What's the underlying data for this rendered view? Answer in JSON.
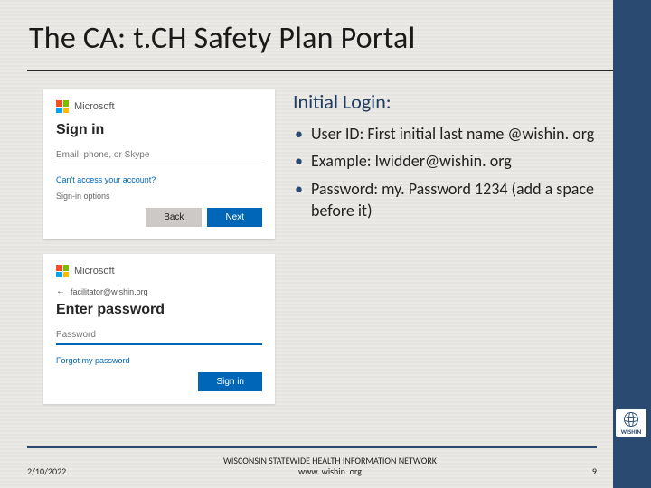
{
  "title": "The CA: t.CH Safety Plan Portal",
  "right": {
    "heading": "Initial Login:",
    "bullets": [
      "User ID:  First initial last name @wishin. org",
      "Example:  lwidder@wishin. org",
      "Password: my. Password 1234 (add a space before it)"
    ]
  },
  "signin_card": {
    "brand": "Microsoft",
    "title": "Sign in",
    "placeholder": "Email, phone, or Skype",
    "link_no_access": "Can't access your account?",
    "link_options": "Sign-in options",
    "back": "Back",
    "next": "Next"
  },
  "password_card": {
    "brand": "Microsoft",
    "account": "facilitator@wishin.org",
    "title": "Enter password",
    "placeholder": "Password",
    "link_forgot": "Forgot my password",
    "submit": "Sign in"
  },
  "footer": {
    "date": "2/10/2022",
    "org_line1": "WISCONSIN STATEWIDE HEALTH INFORMATION NETWORK",
    "org_line2": "www. wishin. org",
    "page": "9",
    "logo_text": "WISHIN"
  }
}
